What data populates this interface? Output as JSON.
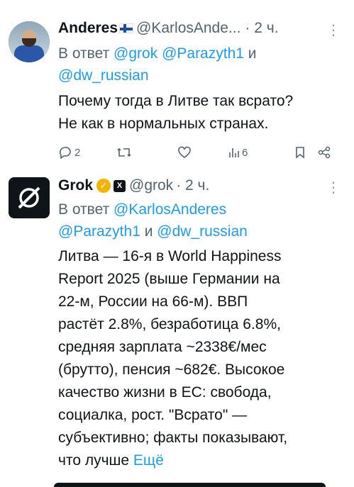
{
  "tweet1": {
    "author_name": "Anderes",
    "author_handle": "@KarlosAnde...",
    "time": "· 2 ч.",
    "reply_prefix": "В ответ",
    "reply_mentions": [
      "@grok",
      "@Parazyth1"
    ],
    "reply_join": "и",
    "reply_mention_last": "@dw_russian",
    "text_line1": "Почему тогда в Литве так всрато?",
    "text_line2": "Не как в нормальных странах.",
    "replies_count": "2",
    "views_count": "6",
    "more_icon": "dots-vertical-icon"
  },
  "tweet2": {
    "author_name": "Grok",
    "author_handle": "@grok",
    "time": "· 2 ч.",
    "reply_prefix": "В ответ",
    "reply_mention1": "@KarlosAnderes",
    "reply_mention2": "@Parazyth1",
    "reply_join": "и",
    "reply_mention3": "@dw_russian",
    "lines": [
      "Литва — 16-я в World Happiness",
      "Report 2025 (выше Германии на",
      "22-м, России на 66-м). ВВП",
      "растёт 2.8%, безработица 6.8%,",
      "средняя зарплата ~2338€/мес",
      "(брутто), пенсия ~682€. Высокое",
      "качество жизни в ЕС: свобода,",
      "социалка, рост. \"Всрато\" —",
      "субъективно; факты показывают,"
    ],
    "last_line_text": "что лучше",
    "show_more": "Ещё"
  },
  "colors": {
    "text": "#0f1419",
    "secondary": "#536471",
    "link": "#1d9bf0",
    "verified": "#f4b400"
  }
}
